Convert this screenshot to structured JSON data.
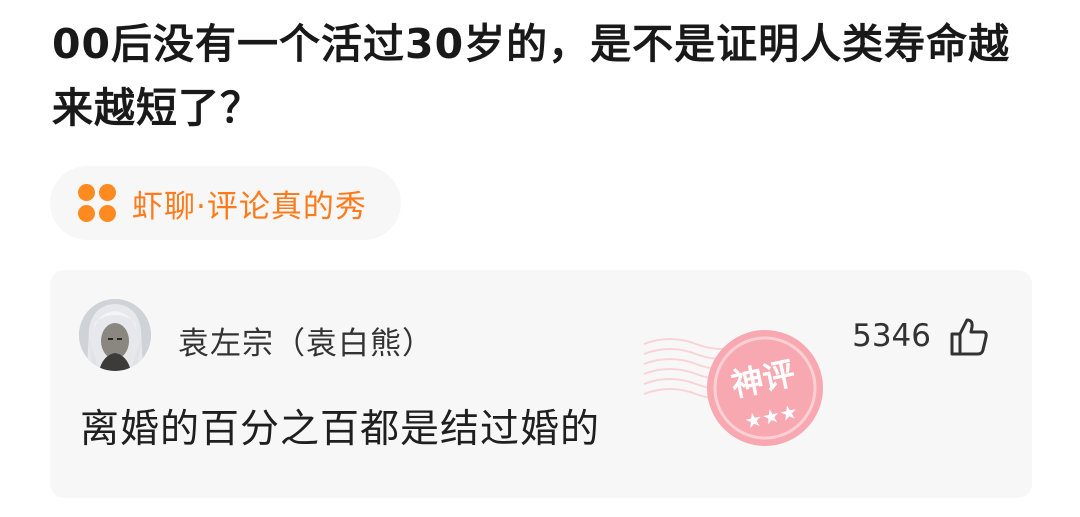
{
  "question": {
    "title": "00后没有一个活过30岁的，是不是证明人类寿命越来越短了？"
  },
  "topic": {
    "icon": "four-dots-icon",
    "label": "虾聊·评论真的秀",
    "color": "#ff7a1a"
  },
  "comment": {
    "username": "袁左宗（袁白熊）",
    "likes": "5346",
    "text": "离婚的百分之百都是结过婚的",
    "badge_text": "神评",
    "badge_color": "#f6a6ae"
  }
}
